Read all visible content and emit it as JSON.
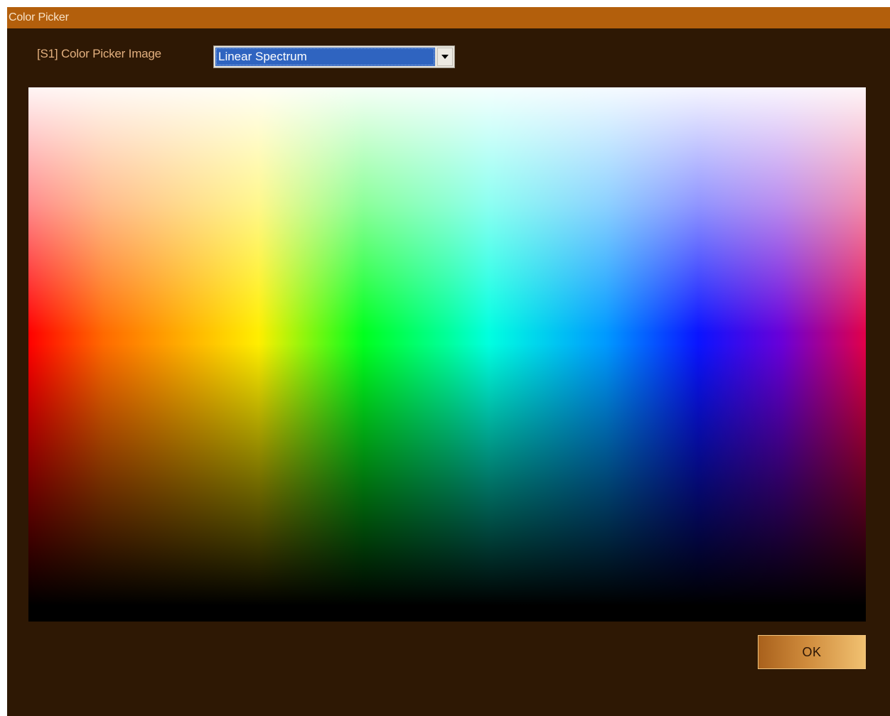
{
  "window": {
    "title": "Color Picker"
  },
  "picker": {
    "label": "[S1] Color Picker Image",
    "selected": "Linear Spectrum"
  },
  "buttons": {
    "ok_label": "OK"
  },
  "icons": {
    "dropdown": "chevron-down-icon"
  },
  "colors": {
    "titlebar": "#b35f0c",
    "background": "#2e1804",
    "label_text": "#e3b07f",
    "selection": "#2f64c0"
  }
}
